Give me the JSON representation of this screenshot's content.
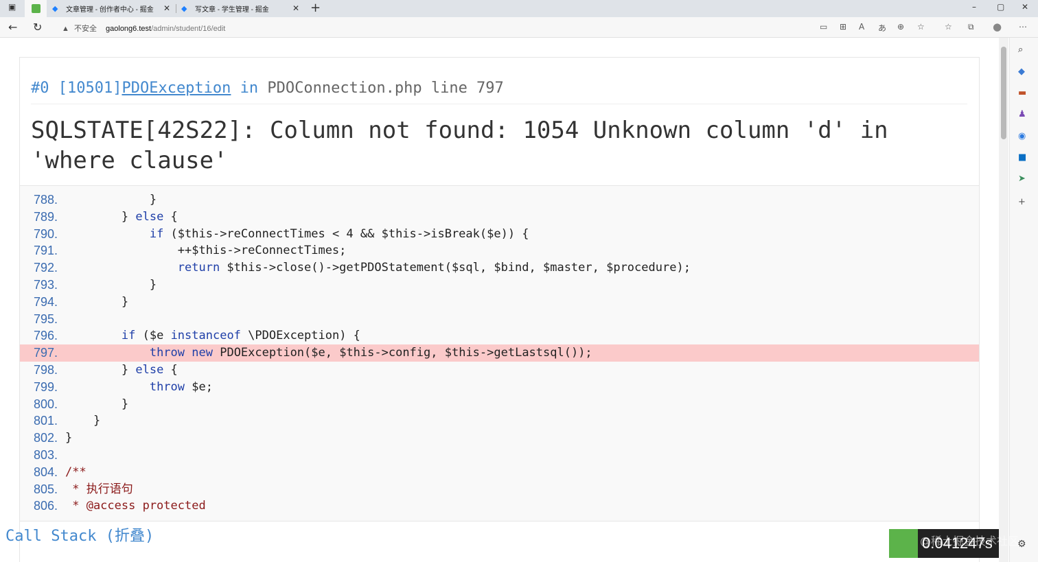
{
  "browser": {
    "tabs": [
      {
        "title": "文章管理 - 创作者中心 - 掘金"
      },
      {
        "title": "写文章 - 学生管理 - 掘金"
      }
    ],
    "new_tab": "+",
    "insecure_label": "不安全",
    "url_host": "gaolong6.test",
    "url_path": "/admin/student/16/edit"
  },
  "exception": {
    "index": "#0",
    "code": "[10501]",
    "class": "PDOException",
    "in": "in",
    "file": "PDOConnection.php line 797",
    "message": "SQLSTATE[42S22]: Column not found: 1054 Unknown column 'd' in 'where clause'"
  },
  "code_lines": [
    {
      "num": "788.",
      "code": "            }"
    },
    {
      "num": "789.",
      "code": "        } else {"
    },
    {
      "num": "790.",
      "code": "            if ($this->reConnectTimes < 4 && $this->isBreak($e)) {"
    },
    {
      "num": "791.",
      "code": "                ++$this->reConnectTimes;"
    },
    {
      "num": "792.",
      "code": "                return $this->close()->getPDOStatement($sql, $bind, $master, $procedure);"
    },
    {
      "num": "793.",
      "code": "            }"
    },
    {
      "num": "794.",
      "code": "        }"
    },
    {
      "num": "795.",
      "code": ""
    },
    {
      "num": "796.",
      "code": "        if ($e instanceof \\PDOException) {"
    },
    {
      "num": "797.",
      "code": "            throw new PDOException($e, $this->config, $this->getLastsql());",
      "highlight": true
    },
    {
      "num": "798.",
      "code": "        } else {"
    },
    {
      "num": "799.",
      "code": "            throw $e;"
    },
    {
      "num": "800.",
      "code": "        }"
    },
    {
      "num": "801.",
      "code": "    }"
    },
    {
      "num": "802.",
      "code": "}"
    },
    {
      "num": "803.",
      "code": ""
    },
    {
      "num": "804.",
      "code": "/**"
    },
    {
      "num": "805.",
      "code": " * 执行语句"
    },
    {
      "num": "806.",
      "code": " * @access protected"
    }
  ],
  "call_stack_label": "Call Stack (折叠)",
  "timer": "0.041247s",
  "watermark": "@稀土掘金技术社区"
}
